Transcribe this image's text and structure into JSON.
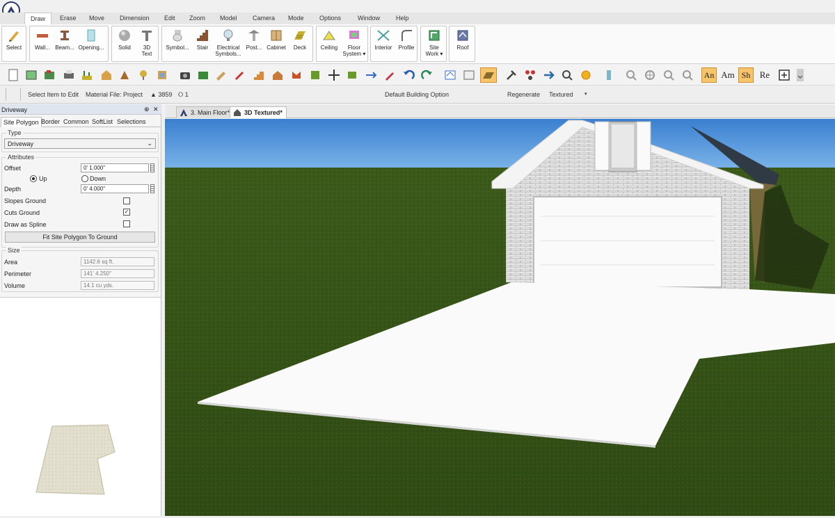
{
  "menu": [
    "Draw",
    "Erase",
    "Move",
    "Dimension",
    "Edit",
    "Zoom",
    "Model",
    "Camera",
    "Mode",
    "Options",
    "Window",
    "Help"
  ],
  "ribbon": {
    "select": "Select",
    "wall": "Wall...",
    "beam": "Beam...",
    "opening": "Opening...",
    "solid": "Solid",
    "text3d_1": "3D",
    "text3d_2": "Text",
    "symbol": "Symbol...",
    "stair": "Stair",
    "electrical_1": "Electrical",
    "electrical_2": "Symbols...",
    "post": "Post...",
    "cabinet": "Cabinet",
    "deck": "Deck",
    "ceiling": "Ceiling",
    "floor_1": "Floor",
    "floor_2": "System ▾",
    "interior": "Interior",
    "profile": "Profile",
    "site_1": "Site",
    "site_2": "Work ▾",
    "roof": "Roof"
  },
  "textbuttons": [
    "An",
    "Am",
    "Sh",
    "Re"
  ],
  "status": {
    "select_item": "Select Item to Edit",
    "material_file": "Material File: Project",
    "triangles": "▲ 3859",
    "lights": "⭘ 1",
    "building_option": "Default Building Option",
    "regenerate": "Regenerate",
    "render_mode": "Textured"
  },
  "panel": {
    "title": "Driveway",
    "pin": "⊕",
    "close": "✕",
    "tabs": [
      "Site Polygon",
      "Border",
      "Common",
      "SoftList",
      "Selections"
    ],
    "type_section": "Type",
    "type_value": "Driveway",
    "attributes_section": "Attributes",
    "offset_label": "Offset",
    "offset_value": "0' 1.000\"",
    "up_label": "Up",
    "down_label": "Down",
    "depth_label": "Depth",
    "depth_value": "0' 4.000\"",
    "slopes_label": "Slopes Ground",
    "slopes_checked": false,
    "cuts_label": "Cuts Ground",
    "cuts_checked": true,
    "spline_label": "Draw as Spline",
    "spline_checked": false,
    "fit_button": "Fit Site Polygon To Ground",
    "size_section": "Size",
    "area_label": "Area",
    "area_value": "1142.6 sq ft.",
    "perimeter_label": "Perimeter",
    "perimeter_value": "141' 4.250\"",
    "volume_label": "Volume",
    "volume_value": "14.1 cu yds."
  },
  "views": {
    "tab1": "3. Main Floor*",
    "tab2": "3D Textured*"
  },
  "colors": {
    "accent": "#f6c46b",
    "sky": "#4d8fd6",
    "grass": "#3b5a1a",
    "driveway": "#fafafa"
  }
}
